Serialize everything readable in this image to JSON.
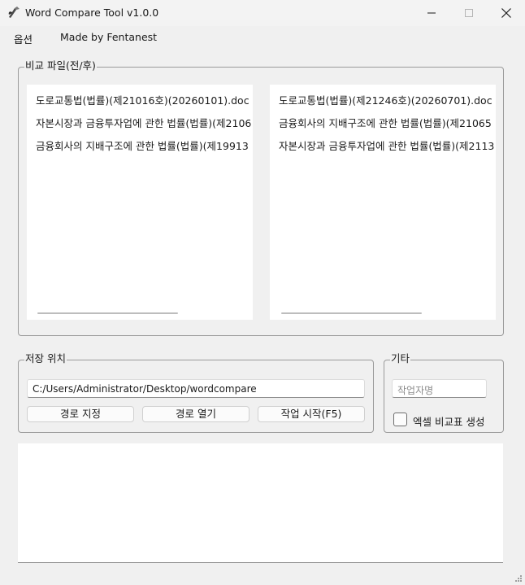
{
  "window": {
    "title": "Word Compare Tool v1.0.0"
  },
  "menu": {
    "options_label": "옵션",
    "credit_label": "Made by Fentanest"
  },
  "compare_files": {
    "group_label": "비교 파일(전/후)",
    "before_list": [
      "도로교통법(법률)(제21016호)(20260101).doc",
      "자본시장과 금융투자업에 관한 법률(법률)(제2106",
      "금융회사의 지배구조에 관한 법률(법률)(제19913"
    ],
    "after_list": [
      "도로교통법(법률)(제21246호)(20260701).doc",
      "금융회사의 지배구조에 관한 법률(법률)(제21065",
      "자본시장과 금융투자업에 관한 법률(법률)(제2113"
    ]
  },
  "save_location": {
    "group_label": "저장 위치",
    "path_value": "C:/Users/Administrator/Desktop/wordcompare",
    "set_path_label": "경로 지정",
    "open_path_label": "경로 열기",
    "start_label": "작업 시작(F5)"
  },
  "other": {
    "group_label": "기타",
    "author_placeholder": "작업자명",
    "excel_checkbox_label": "엑셀 비교표 생성",
    "excel_checked": false
  }
}
